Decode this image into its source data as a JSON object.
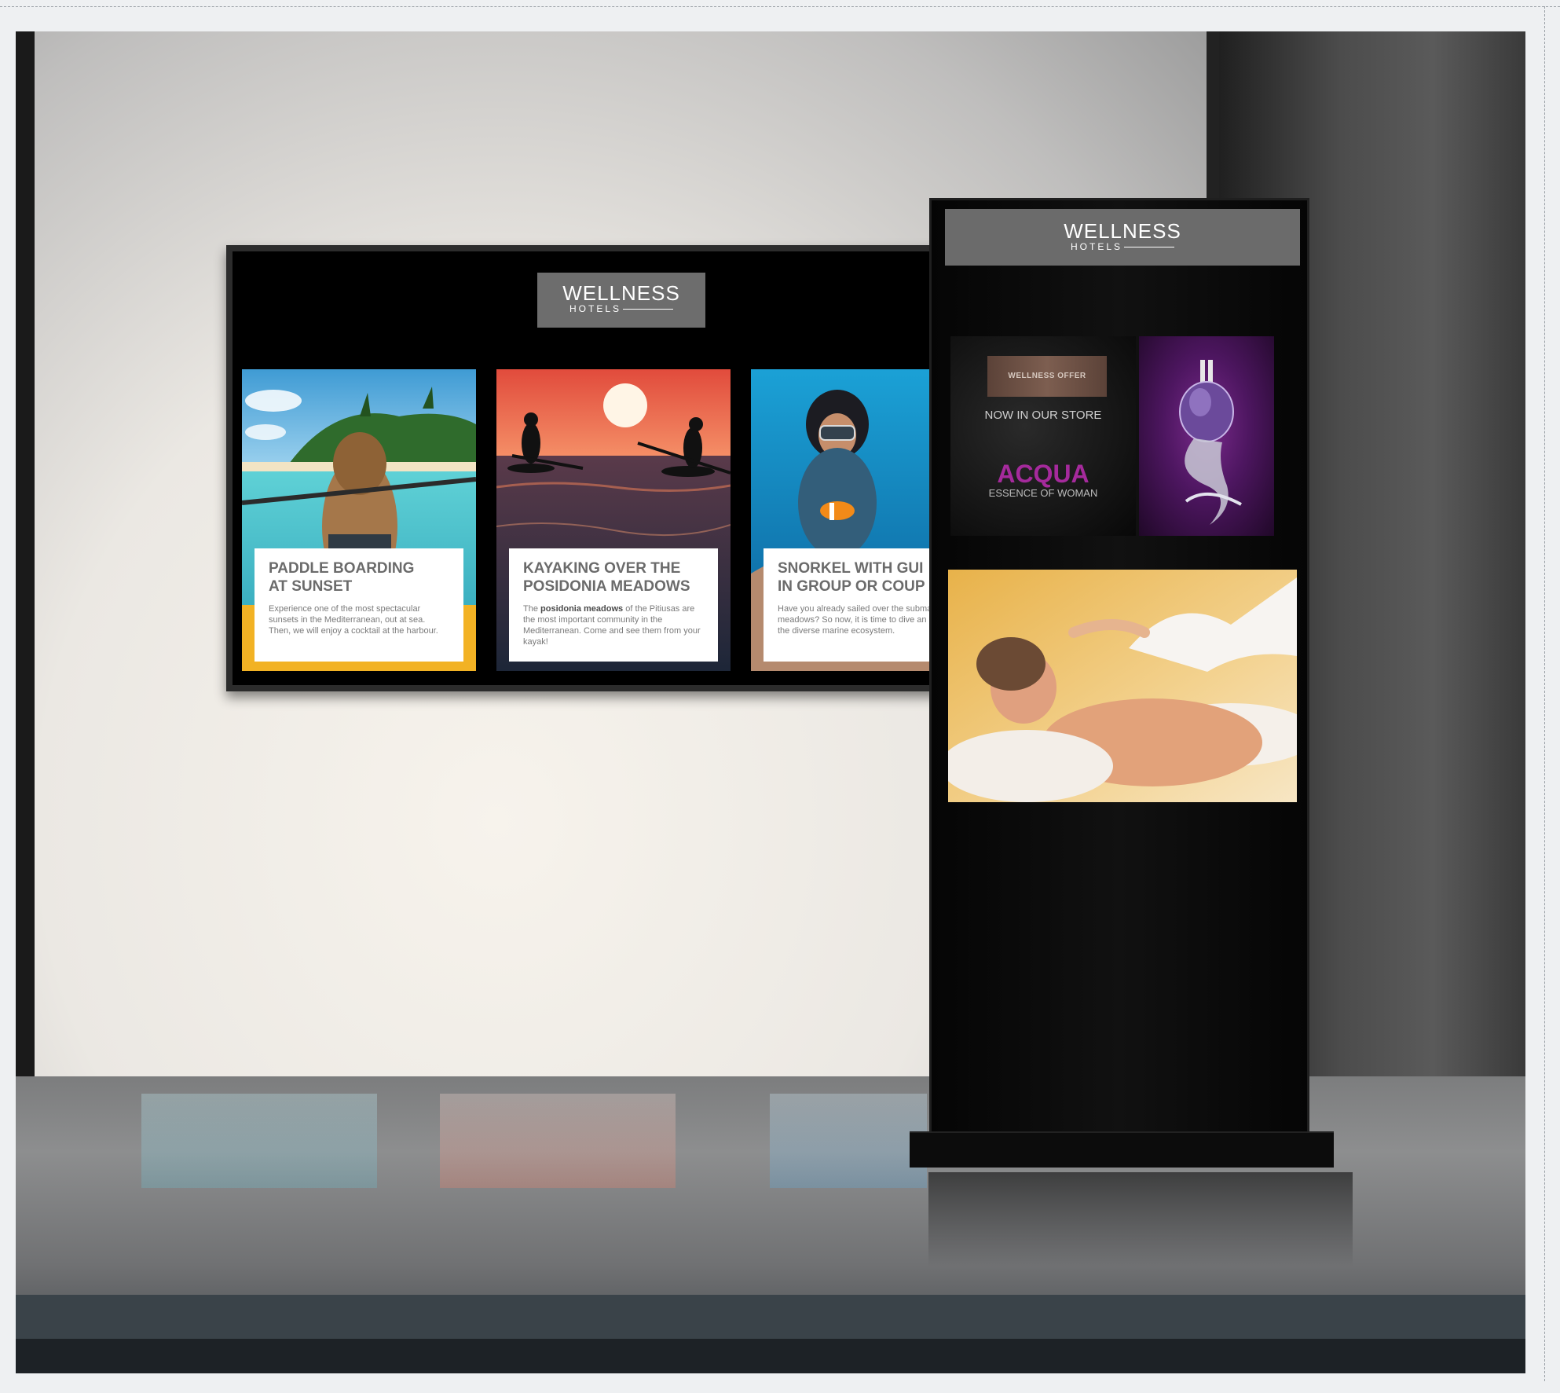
{
  "wall_display": {
    "logo": {
      "name": "WELLNESS",
      "sub": "HOTELS"
    },
    "cards": [
      {
        "title": "PADDLE BOARDING\nAT SUNSET",
        "text": "Experience one of the most spectacular sunsets in the Mediterranean, out at sea. Then, we will enjoy a cocktail at the harbour."
      },
      {
        "title": "KAYAKING OVER THE\nPOSIDONIA MEADOWS",
        "text_before": "The ",
        "text_bold": "posidonia meadows",
        "text_after": " of the Pitiusas are the most important community in the Mediterranean. Come and see them from your kayak!"
      },
      {
        "title": "SNORKEL WITH GUI\nIN GROUP OR COUP",
        "text": "Have you already sailed over the subma meadows? So now, it is time to dive an explore the diverse marine ecosystem."
      }
    ]
  },
  "kiosk": {
    "logo": {
      "name": "WELLNESS",
      "sub": "HOTELS"
    },
    "ad": {
      "badge": "WELLNESS OFFER",
      "headline": "NOW IN OUR STORE",
      "product": "ACQUA",
      "tagline": "ESSENCE OF WOMAN"
    }
  },
  "colors": {
    "logo_panel": "#6b6b6b",
    "acqua_purple": "#a52a9c",
    "offer_badge": "#6e5246"
  },
  "icons": [
    "perfume-bottle-image",
    "spa-massage-image",
    "paddle-boarding-photo",
    "kayak-sunset-photo",
    "snorkel-photo"
  ]
}
